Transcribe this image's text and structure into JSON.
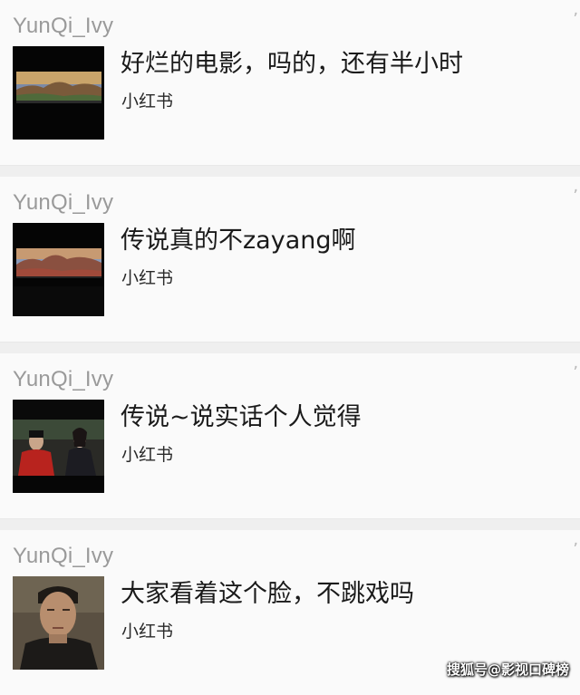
{
  "feed": {
    "items": [
      {
        "username": "YunQi_Ivy",
        "message": "好烂的电影，吗的，还有半小时",
        "source": "小红书",
        "corner": "ʼ",
        "thumbnail": "movie-theater-screen-landscape"
      },
      {
        "username": "YunQi_Ivy",
        "message": "传说真的不zayang啊",
        "source": "小红书",
        "corner": "ʼ",
        "thumbnail": "movie-theater-screen-landscape"
      },
      {
        "username": "YunQi_Ivy",
        "message": "传说~说实话个人觉得",
        "source": "小红书",
        "corner": "ʼ",
        "thumbnail": "movie-scene-red-robes"
      },
      {
        "username": "YunQi_Ivy",
        "message": "大家看着这个脸，不跳戏吗",
        "source": "小红书",
        "corner": "ʼ",
        "thumbnail": "actor-face-closeup"
      }
    ]
  },
  "watermark": {
    "text": "搜狐号@影视口碑榜"
  },
  "colors": {
    "background": "#f7f7f7",
    "username": "#9a9a9a",
    "message": "#1a1a1a",
    "source": "#2a2a2a"
  }
}
